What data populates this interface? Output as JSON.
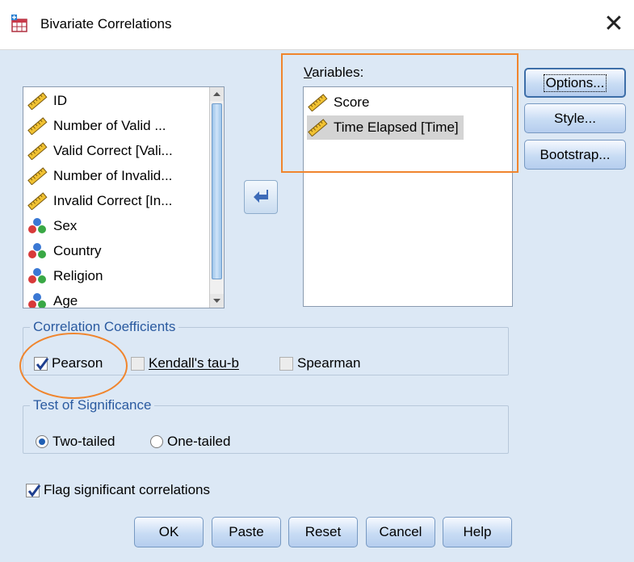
{
  "window": {
    "title": "Bivariate Correlations",
    "close_glyph": "✕"
  },
  "source_list": {
    "items": [
      {
        "label": "ID",
        "icon": "scale-ruler-icon"
      },
      {
        "label": "Number of Valid ...",
        "icon": "scale-ruler-icon"
      },
      {
        "label": "Valid Correct [Vali...",
        "icon": "scale-ruler-icon"
      },
      {
        "label": "Number of Invalid...",
        "icon": "scale-ruler-icon"
      },
      {
        "label": "Invalid Correct [In...",
        "icon": "scale-ruler-icon"
      },
      {
        "label": "Sex",
        "icon": "nominal-balls-icon"
      },
      {
        "label": "Country",
        "icon": "nominal-balls-icon"
      },
      {
        "label": "Religion",
        "icon": "nominal-balls-icon"
      },
      {
        "label": "Age",
        "icon": "nominal-balls-icon"
      }
    ]
  },
  "variables": {
    "label": "Variables:",
    "items": [
      {
        "label": "Score",
        "icon": "scale-ruler-icon"
      },
      {
        "label": "Time Elapsed [Time]",
        "icon": "scale-ruler-icon",
        "selected": true
      }
    ]
  },
  "side_buttons": {
    "options": "Options...",
    "style": "Style...",
    "bootstrap": "Bootstrap..."
  },
  "correlation_coefficients": {
    "legend": "Correlation Coefficients",
    "pearson": {
      "label": "Pearson",
      "checked": true
    },
    "kendall": {
      "label": "Kendall's tau-b",
      "checked": false
    },
    "spearman": {
      "label": "Spearman",
      "checked": false
    }
  },
  "test_of_significance": {
    "legend": "Test of Significance",
    "two_tailed": {
      "label": "Two-tailed",
      "selected": true
    },
    "one_tailed": {
      "label": "One-tailed",
      "selected": false
    }
  },
  "flag": {
    "label": "Flag significant correlations",
    "checked": true
  },
  "buttons": {
    "ok": "OK",
    "paste": "Paste",
    "reset": "Reset",
    "cancel": "Cancel",
    "help": "Help"
  },
  "colors": {
    "client_bg": "#dce8f5",
    "annotation": "#f0852d",
    "legend_text": "#2a5aa0"
  }
}
